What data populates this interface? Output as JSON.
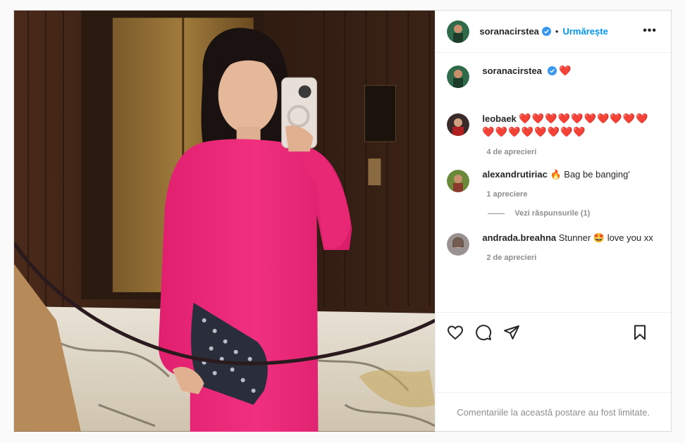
{
  "author": {
    "username": "soranacirstea",
    "follow_label": "Urmărește",
    "separator": "•",
    "more": "•••"
  },
  "caption": {
    "username": "soranacirstea",
    "text": "❤️"
  },
  "comments": [
    {
      "username": "leobaek",
      "text": "❤️❤️❤️❤️❤️❤️❤️❤️❤️❤️❤️❤️❤️❤️❤️❤️❤️❤️",
      "likes": "4 de aprecieri"
    },
    {
      "username": "alexandrutiriac",
      "text": "🔥 Bag be banging'",
      "likes": "1 apreciere"
    },
    {
      "username": "andrada.breahna",
      "text": "Stunner 🤩 love you xx",
      "likes": "2 de aprecieri"
    }
  ],
  "replies_label": "Vezi răspunsurile (1)",
  "limited_notice": "Comentariile la această postare au fost limitate.",
  "colors": {
    "accent": "#0095f6",
    "verified": "#3897f0",
    "dress": "#e8237a",
    "muted": "#8e8e8e"
  },
  "icons": [
    "like-icon",
    "comment-icon",
    "share-icon",
    "save-icon",
    "verified-icon"
  ]
}
